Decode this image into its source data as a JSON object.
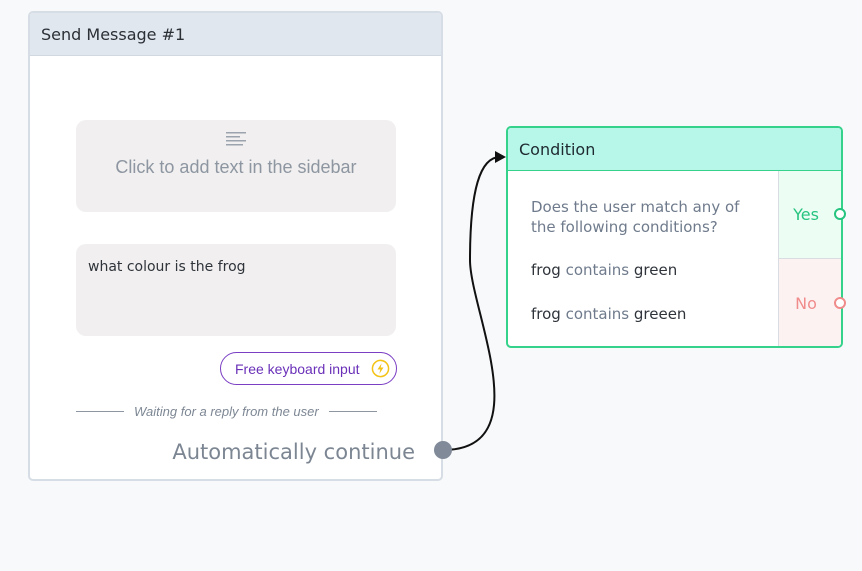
{
  "send_message_node": {
    "title": "Send Message #1",
    "placeholder_text": "Click to add text in the sidebar",
    "message_text": "what colour is the frog",
    "keyboard_input_label": "Free keyboard input",
    "waiting_label": "Waiting for a reply from the user",
    "auto_continue_label": "Automatically continue"
  },
  "condition_node": {
    "title": "Condition",
    "question": "Does the user match any of the following conditions?",
    "rules": [
      {
        "field": "frog",
        "operator": "contains",
        "value": "green"
      },
      {
        "field": "frog",
        "operator": "contains",
        "value": "greeen"
      }
    ],
    "yes_label": "Yes",
    "no_label": "No"
  },
  "colors": {
    "canvas_bg": "#f8f9fb",
    "condition_accent": "#34d28b",
    "yes_color": "#26c47f",
    "no_color": "#f08c8c",
    "keyboard_accent": "#7b3fc4",
    "bolt_color": "#f3c318"
  },
  "icons": {
    "placeholder_icon": "text-lines-icon",
    "keyboard_icon": "lightning-bolt-icon"
  }
}
